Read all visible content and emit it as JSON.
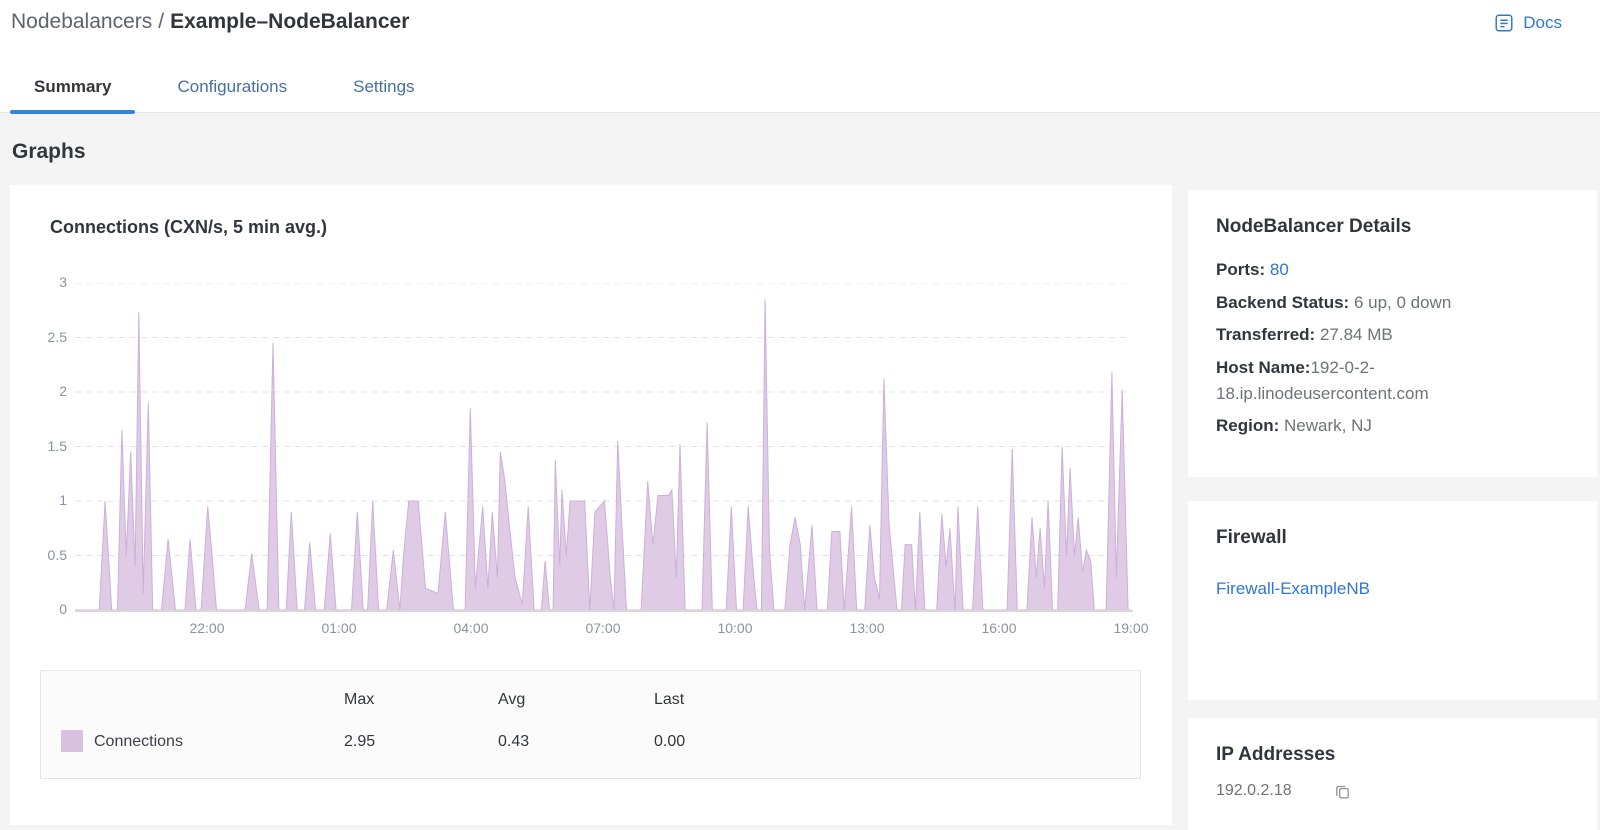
{
  "breadcrumb": {
    "section": "Nodebalancers",
    "separator": "/",
    "current": "Example–NodeBalancer"
  },
  "docs": {
    "label": "Docs"
  },
  "tabs": [
    {
      "label": "Summary",
      "active": true
    },
    {
      "label": "Configurations",
      "active": false
    },
    {
      "label": "Settings",
      "active": false
    }
  ],
  "page_heading": "Graphs",
  "chart_panel": {
    "title": "Connections (CXN/s, 5 min avg.)"
  },
  "chart_data": {
    "type": "area",
    "title": "Connections (CXN/s, 5 min avg.)",
    "series_name": "Connections",
    "unit": "CXN/s (5 min avg.)",
    "time_span": "24 hours ending 19:00",
    "x_tick_labels": [
      "22:00",
      "01:00",
      "04:00",
      "07:00",
      "10:00",
      "13:00",
      "16:00",
      "19:00"
    ],
    "x_tick_minutes": [
      180,
      360,
      540,
      720,
      900,
      1080,
      1260,
      1440
    ],
    "x_total_minutes": 1440,
    "ylim": [
      0,
      3
    ],
    "y_ticks": [
      0,
      0.5,
      1,
      1.5,
      2,
      2.5,
      3
    ],
    "grid": "dashed horizontal gridlines",
    "legend_position": "table below chart",
    "stats": {
      "max": 2.95,
      "avg": 0.43,
      "last": 0.0
    },
    "points_minutes_value": [
      [
        0,
        0
      ],
      [
        25,
        0
      ],
      [
        33,
        0
      ],
      [
        41,
        1.0
      ],
      [
        50,
        0
      ],
      [
        58,
        0
      ],
      [
        64,
        1.65
      ],
      [
        70,
        0.5
      ],
      [
        76,
        1.45
      ],
      [
        82,
        0.4
      ],
      [
        87,
        2.73
      ],
      [
        93,
        0.15
      ],
      [
        100,
        1.9
      ],
      [
        106,
        0
      ],
      [
        118,
        0
      ],
      [
        127,
        0.65
      ],
      [
        137,
        0
      ],
      [
        150,
        0
      ],
      [
        157,
        0.65
      ],
      [
        165,
        0
      ],
      [
        172,
        0
      ],
      [
        181,
        0.95
      ],
      [
        187,
        0.5
      ],
      [
        193,
        0
      ],
      [
        232,
        0
      ],
      [
        241,
        0.52
      ],
      [
        251,
        0
      ],
      [
        262,
        0
      ],
      [
        270,
        2.45
      ],
      [
        278,
        0
      ],
      [
        288,
        0
      ],
      [
        295,
        0.9
      ],
      [
        303,
        0
      ],
      [
        313,
        0
      ],
      [
        320,
        0.62
      ],
      [
        328,
        0
      ],
      [
        340,
        0
      ],
      [
        348,
        0.7
      ],
      [
        356,
        0
      ],
      [
        377,
        0
      ],
      [
        385,
        0.9
      ],
      [
        393,
        0
      ],
      [
        399,
        0
      ],
      [
        406,
        1.0
      ],
      [
        414,
        0
      ],
      [
        425,
        0
      ],
      [
        434,
        0.55
      ],
      [
        443,
        0
      ],
      [
        448,
        0.5
      ],
      [
        455,
        1.0
      ],
      [
        468,
        1.0
      ],
      [
        478,
        0.2
      ],
      [
        495,
        0.15
      ],
      [
        505,
        0.9
      ],
      [
        516,
        0
      ],
      [
        532,
        0
      ],
      [
        539,
        1.85
      ],
      [
        546,
        0.2
      ],
      [
        556,
        0.95
      ],
      [
        563,
        0.2
      ],
      [
        569,
        0.9
      ],
      [
        576,
        0.3
      ],
      [
        580,
        1.45
      ],
      [
        586,
        1.2
      ],
      [
        592,
        0.8
      ],
      [
        600,
        0.3
      ],
      [
        610,
        0.05
      ],
      [
        618,
        0.95
      ],
      [
        626,
        0
      ],
      [
        636,
        0
      ],
      [
        641,
        0.45
      ],
      [
        647,
        0
      ],
      [
        652,
        0
      ],
      [
        655,
        1.38
      ],
      [
        661,
        0.4
      ],
      [
        664,
        1.1
      ],
      [
        670,
        0.5
      ],
      [
        675,
        1.0
      ],
      [
        695,
        1.0
      ],
      [
        702,
        0
      ],
      [
        709,
        0.9
      ],
      [
        722,
        1.0
      ],
      [
        730,
        0.3
      ],
      [
        735,
        0
      ],
      [
        740,
        1.55
      ],
      [
        746,
        0.75
      ],
      [
        752,
        0
      ],
      [
        772,
        0
      ],
      [
        781,
        1.18
      ],
      [
        788,
        0.6
      ],
      [
        795,
        1.05
      ],
      [
        809,
        1.05
      ],
      [
        814,
        1.1
      ],
      [
        820,
        0.3
      ],
      [
        825,
        1.52
      ],
      [
        832,
        0
      ],
      [
        855,
        0
      ],
      [
        862,
        1.72
      ],
      [
        869,
        0
      ],
      [
        888,
        0
      ],
      [
        895,
        0.95
      ],
      [
        902,
        0
      ],
      [
        911,
        0
      ],
      [
        918,
        0.95
      ],
      [
        925,
        0.35
      ],
      [
        930,
        0
      ],
      [
        936,
        0
      ],
      [
        941,
        2.85
      ],
      [
        947,
        0.55
      ],
      [
        953,
        0
      ],
      [
        968,
        0
      ],
      [
        975,
        0.6
      ],
      [
        982,
        0.85
      ],
      [
        989,
        0.6
      ],
      [
        995,
        0
      ],
      [
        1005,
        0.78
      ],
      [
        1012,
        0
      ],
      [
        1026,
        0
      ],
      [
        1032,
        0.72
      ],
      [
        1043,
        0.72
      ],
      [
        1049,
        0
      ],
      [
        1059,
        0.95
      ],
      [
        1066,
        0
      ],
      [
        1077,
        0
      ],
      [
        1084,
        0.78
      ],
      [
        1090,
        0.3
      ],
      [
        1097,
        0.1
      ],
      [
        1103,
        2.12
      ],
      [
        1110,
        0.8
      ],
      [
        1116,
        0.35
      ],
      [
        1121,
        0
      ],
      [
        1127,
        0
      ],
      [
        1132,
        0.6
      ],
      [
        1141,
        0.6
      ],
      [
        1146,
        0
      ],
      [
        1152,
        0.9
      ],
      [
        1159,
        0
      ],
      [
        1175,
        0
      ],
      [
        1182,
        0.88
      ],
      [
        1188,
        0.4
      ],
      [
        1193,
        0.75
      ],
      [
        1200,
        0
      ],
      [
        1204,
        0.95
      ],
      [
        1211,
        0
      ],
      [
        1224,
        0
      ],
      [
        1231,
        0.95
      ],
      [
        1238,
        0
      ],
      [
        1271,
        0
      ],
      [
        1278,
        1.48
      ],
      [
        1285,
        0
      ],
      [
        1298,
        0
      ],
      [
        1305,
        0.85
      ],
      [
        1311,
        0.3
      ],
      [
        1316,
        0.75
      ],
      [
        1322,
        0.2
      ],
      [
        1327,
        1.0
      ],
      [
        1333,
        0
      ],
      [
        1340,
        0
      ],
      [
        1346,
        1.5
      ],
      [
        1352,
        0.5
      ],
      [
        1357,
        1.3
      ],
      [
        1363,
        0.5
      ],
      [
        1368,
        0.85
      ],
      [
        1374,
        0.35
      ],
      [
        1379,
        0.55
      ],
      [
        1385,
        0.45
      ],
      [
        1390,
        0
      ],
      [
        1406,
        0
      ],
      [
        1414,
        2.18
      ],
      [
        1420,
        0.3
      ],
      [
        1428,
        2.02
      ],
      [
        1436,
        0
      ],
      [
        1440,
        0
      ]
    ]
  },
  "legend_table": {
    "headers": {
      "max": "Max",
      "avg": "Avg",
      "last": "Last"
    },
    "row": {
      "label": "Connections",
      "swatch_color": "#d9c2e1",
      "max": "2.95",
      "avg": "0.43",
      "last": "0.00"
    }
  },
  "sidebar": {
    "details": {
      "title": "NodeBalancer Details",
      "ports_label": "Ports:",
      "ports_value": "80",
      "backend_label": "Backend Status:",
      "backend_value": "6 up, 0 down",
      "transferred_label": "Transferred:",
      "transferred_value": "27.84 MB",
      "host_label": "Host Name:",
      "host_value": "192-0-2-18.ip.linodeusercontent.com",
      "region_label": "Region:",
      "region_value": "Newark, NJ"
    },
    "firewall": {
      "title": "Firewall",
      "link": "Firewall-ExampleNB"
    },
    "ips": {
      "title": "IP Addresses",
      "ip": "192.0.2.18"
    }
  },
  "colors": {
    "accent_blue": "#3683dc",
    "tab_inactive_blue": "#46709e",
    "area_fill": "#dcc7e3",
    "area_stroke": "#ccb0d9",
    "swatch": "#d9c2e1",
    "text_dark": "#32363c",
    "text_gray": "#6e7378",
    "axis_text": "#8d939c",
    "page_bg": "#f4f4f5"
  }
}
